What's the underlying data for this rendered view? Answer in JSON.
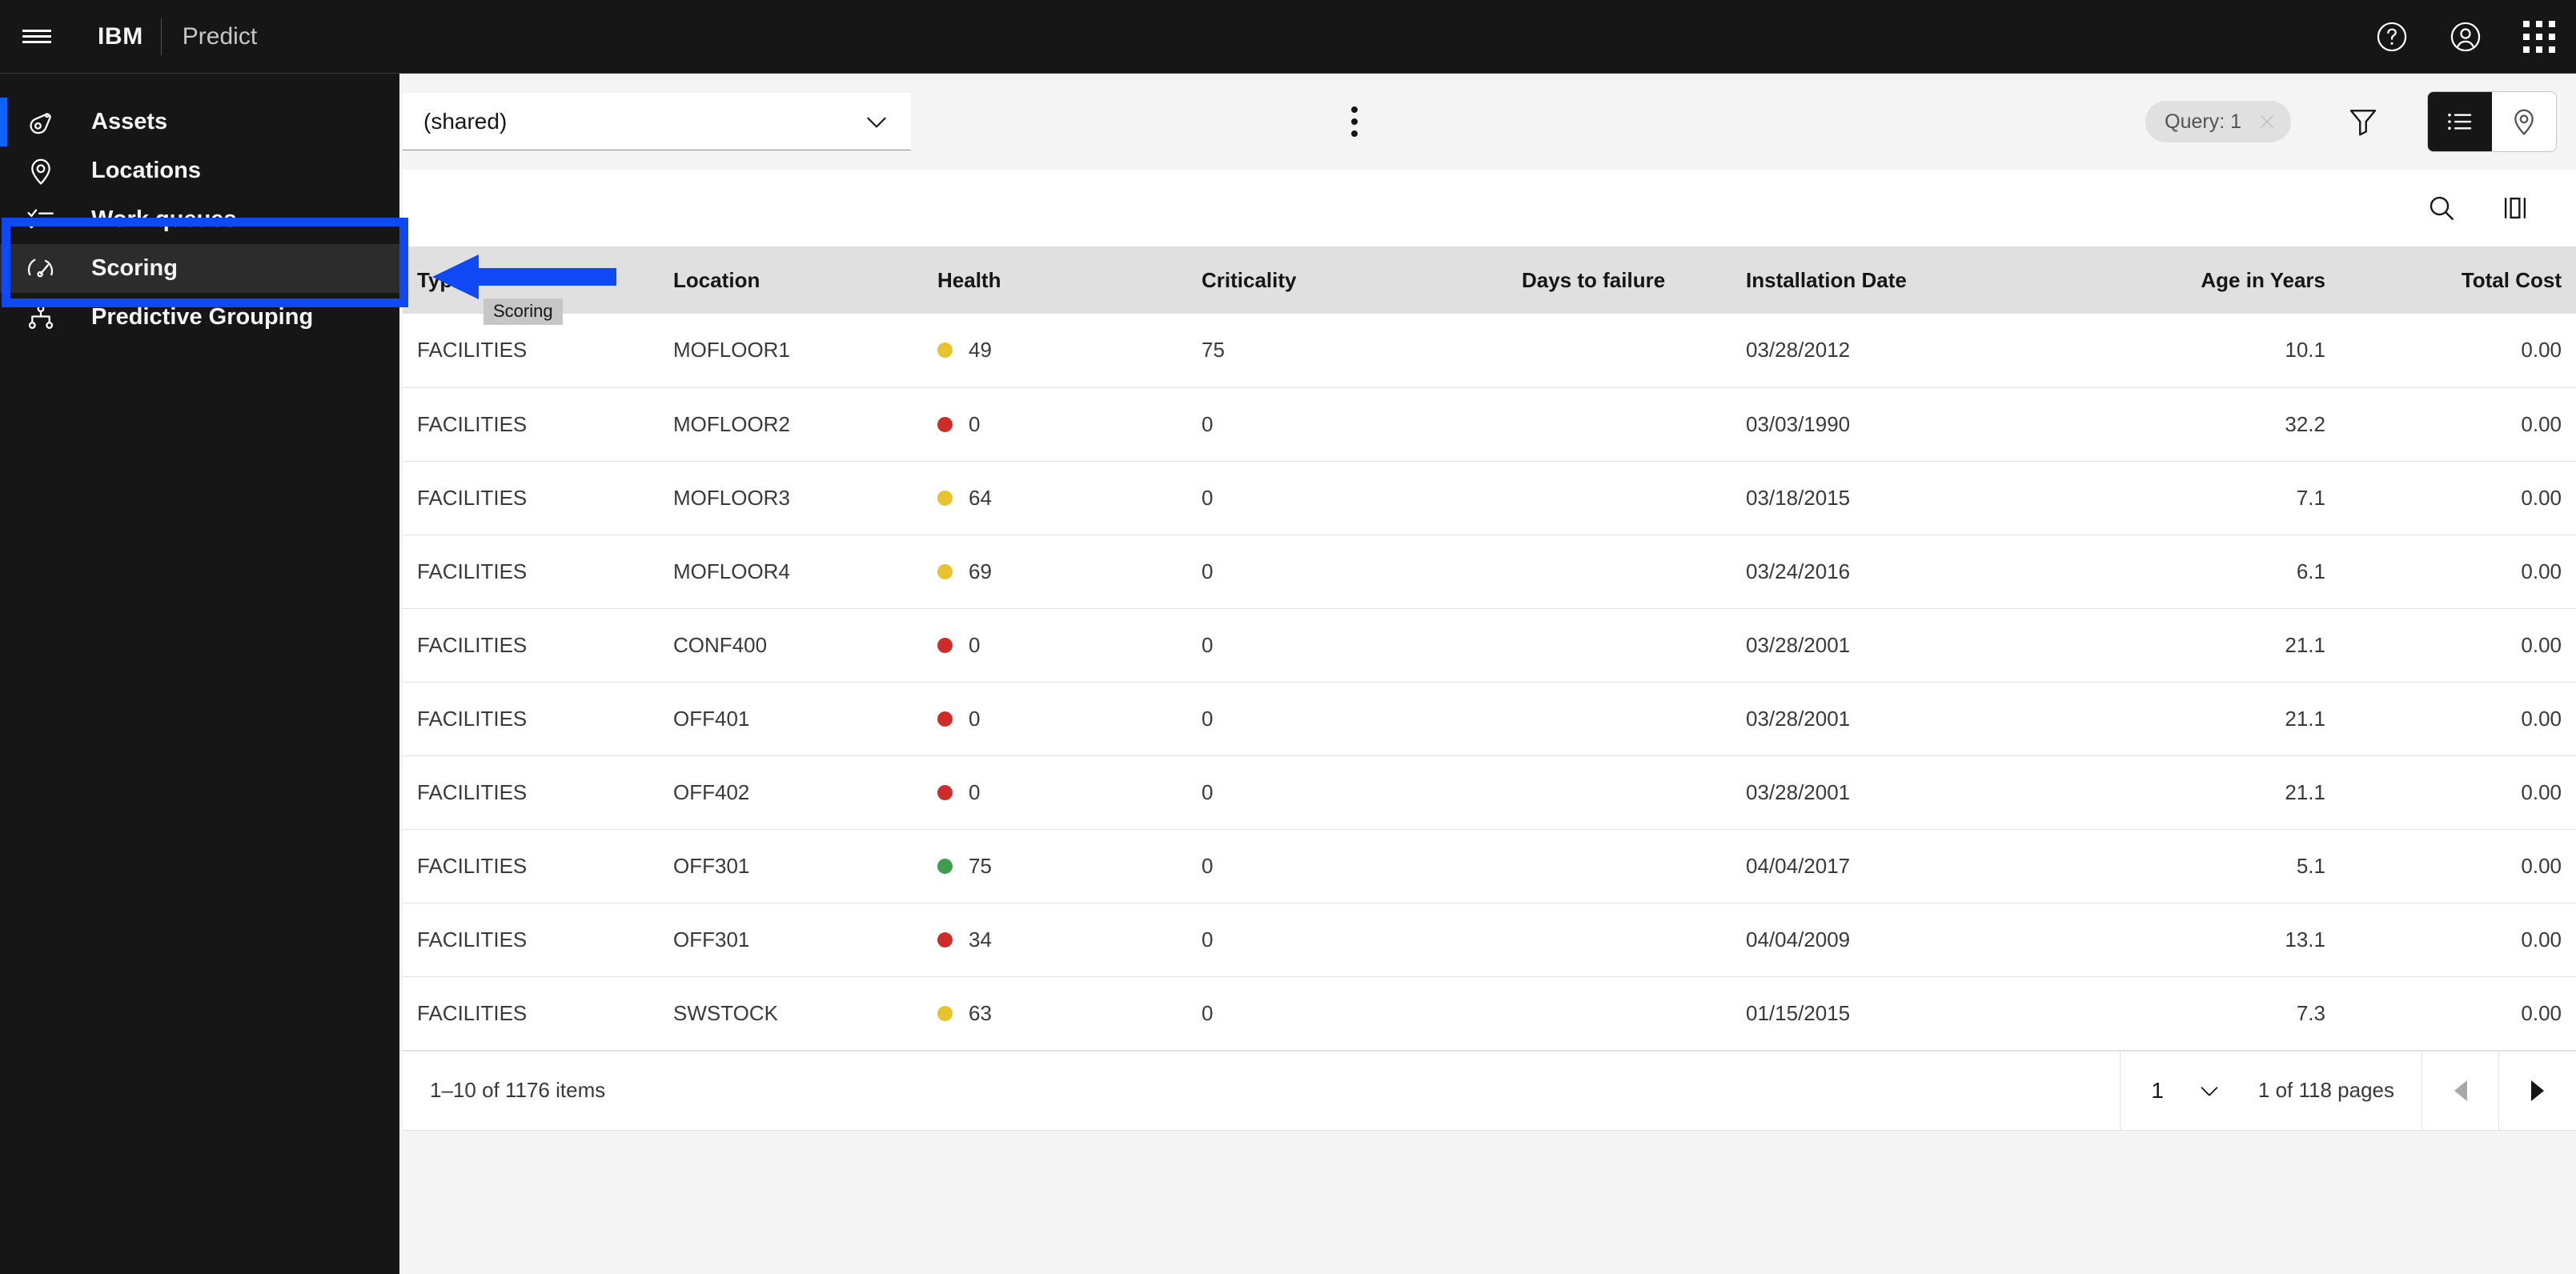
{
  "header": {
    "menu_icon": "hamburger-menu-icon",
    "brand": "IBM",
    "app_name": "Predict",
    "help_icon": "help-circle-icon",
    "account_icon": "user-avatar-icon",
    "switcher_icon": "app-switcher-grid-icon"
  },
  "sidebar": {
    "items": [
      {
        "label": "Assets",
        "icon": "asset-tag-icon",
        "active": true
      },
      {
        "label": "Locations",
        "icon": "map-pin-icon",
        "active": false
      },
      {
        "label": "Work queues",
        "icon": "task-list-icon",
        "active": false
      },
      {
        "label": "Scoring",
        "icon": "gauge-meter-icon",
        "active": false
      },
      {
        "label": "Predictive Grouping",
        "icon": "hierarchy-tree-icon",
        "active": false
      }
    ],
    "highlighted_item": "Scoring",
    "tooltip": "Scoring",
    "accent_color": "#0f62fe",
    "highlight_color": "#0f48f5"
  },
  "toolbar": {
    "select_value": "(shared)",
    "select_icon": "chevron-down-icon",
    "overflow_icon": "overflow-menu-vertical-icon",
    "query_badge": "Query: 1",
    "query_close_icon": "close-icon",
    "filter_icon": "filter-funnel-icon",
    "view_list_icon": "list-view-icon",
    "view_map_icon": "map-pin-view-icon",
    "active_view": "list"
  },
  "table_tools": {
    "search_icon": "search-icon",
    "columns_icon": "column-settings-icon"
  },
  "table": {
    "columns": [
      {
        "key": "type",
        "label": "Type",
        "align": "left"
      },
      {
        "key": "loc",
        "label": "Location",
        "align": "left"
      },
      {
        "key": "health",
        "label": "Health",
        "align": "left"
      },
      {
        "key": "crit",
        "label": "Criticality",
        "align": "left"
      },
      {
        "key": "dtf",
        "label": "Days to failure",
        "align": "left"
      },
      {
        "key": "date",
        "label": "Installation Date",
        "align": "left"
      },
      {
        "key": "age",
        "label": "Age in Years",
        "align": "right"
      },
      {
        "key": "cost",
        "label": "Total Cost",
        "align": "right"
      }
    ],
    "rows": [
      {
        "type": "FACILITIES",
        "loc": "MOFLOOR1",
        "health": "49",
        "health_status": "warning",
        "crit": "75",
        "dtf": "",
        "date": "03/28/2012",
        "age": "10.1",
        "cost": "0.00"
      },
      {
        "type": "FACILITIES",
        "loc": "MOFLOOR2",
        "health": "0",
        "health_status": "critical",
        "crit": "0",
        "dtf": "",
        "date": "03/03/1990",
        "age": "32.2",
        "cost": "0.00"
      },
      {
        "type": "FACILITIES",
        "loc": "MOFLOOR3",
        "health": "64",
        "health_status": "warning",
        "crit": "0",
        "dtf": "",
        "date": "03/18/2015",
        "age": "7.1",
        "cost": "0.00"
      },
      {
        "type": "FACILITIES",
        "loc": "MOFLOOR4",
        "health": "69",
        "health_status": "warning",
        "crit": "0",
        "dtf": "",
        "date": "03/24/2016",
        "age": "6.1",
        "cost": "0.00"
      },
      {
        "type": "FACILITIES",
        "loc": "CONF400",
        "health": "0",
        "health_status": "critical",
        "crit": "0",
        "dtf": "",
        "date": "03/28/2001",
        "age": "21.1",
        "cost": "0.00"
      },
      {
        "type": "FACILITIES",
        "loc": "OFF401",
        "health": "0",
        "health_status": "critical",
        "crit": "0",
        "dtf": "",
        "date": "03/28/2001",
        "age": "21.1",
        "cost": "0.00"
      },
      {
        "type": "FACILITIES",
        "loc": "OFF402",
        "health": "0",
        "health_status": "critical",
        "crit": "0",
        "dtf": "",
        "date": "03/28/2001",
        "age": "21.1",
        "cost": "0.00"
      },
      {
        "type": "FACILITIES",
        "loc": "OFF301",
        "health": "75",
        "health_status": "good",
        "crit": "0",
        "dtf": "",
        "date": "04/04/2017",
        "age": "5.1",
        "cost": "0.00"
      },
      {
        "type": "FACILITIES",
        "loc": "OFF301",
        "health": "34",
        "health_status": "critical",
        "crit": "0",
        "dtf": "",
        "date": "04/04/2009",
        "age": "13.1",
        "cost": "0.00"
      },
      {
        "type": "FACILITIES",
        "loc": "SWSTOCK",
        "health": "63",
        "health_status": "warning",
        "crit": "0",
        "dtf": "",
        "date": "01/15/2015",
        "age": "7.3",
        "cost": "0.00"
      }
    ],
    "status_colors": {
      "good": "#3d9e4d",
      "warning": "#e8c32e",
      "critical": "#ce2b2b"
    }
  },
  "pagination": {
    "items_summary": "1–10 of 1176 items",
    "current_page": "1",
    "page_select_icon": "chevron-down-icon",
    "pages_summary": "1 of 118 pages",
    "prev_icon": "caret-left-icon",
    "next_icon": "caret-right-icon"
  }
}
